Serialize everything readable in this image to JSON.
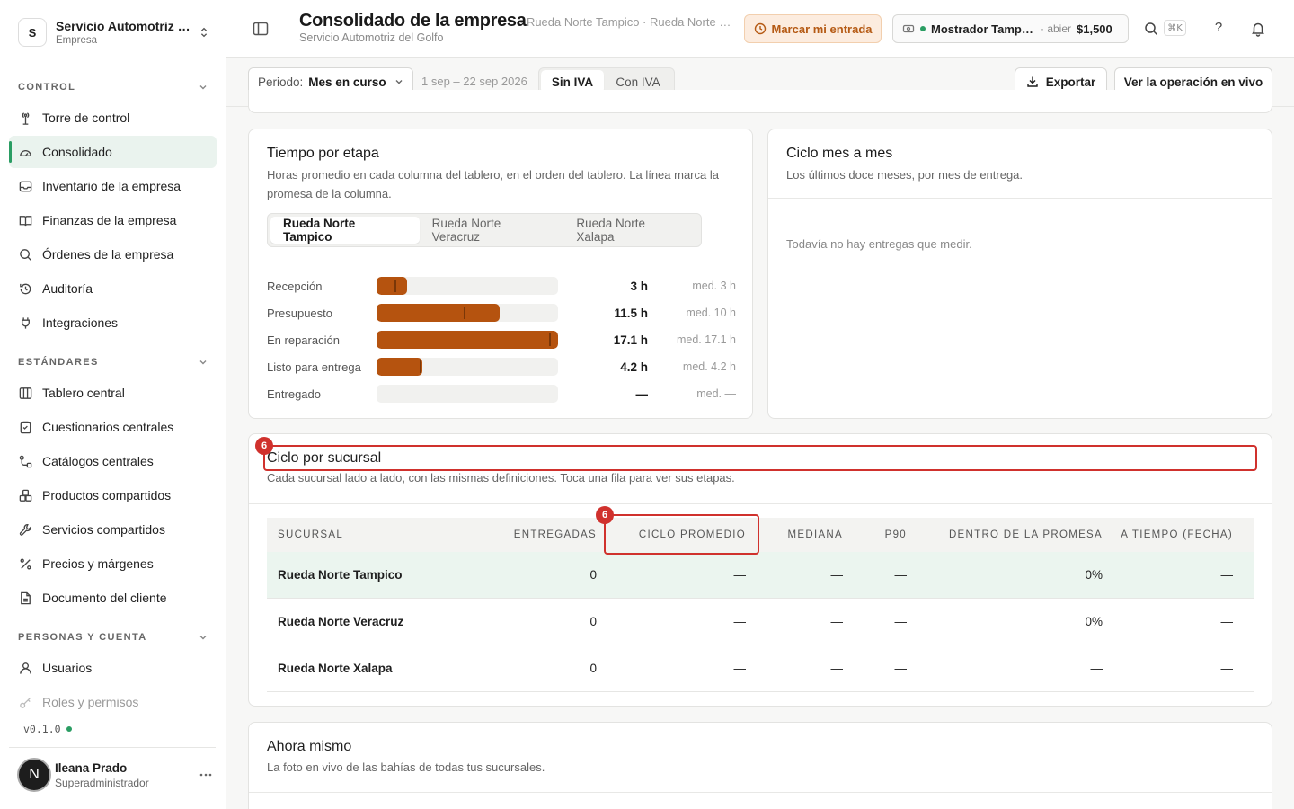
{
  "org": {
    "name": "Servicio Automotriz del Golfo",
    "type": "Empresa",
    "initial": "S"
  },
  "nav": {
    "sections": [
      {
        "label": "CONTROL"
      },
      {
        "label": "ESTÁNDARES"
      },
      {
        "label": "PERSONAS Y CUENTA"
      }
    ],
    "items": [
      {
        "label": "Torre de control",
        "icon": "tower-icon"
      },
      {
        "label": "Consolidado",
        "icon": "dashboard-icon",
        "active": true
      },
      {
        "label": "Inventario de la empresa",
        "icon": "inbox-icon"
      },
      {
        "label": "Finanzas de la empresa",
        "icon": "book-icon"
      },
      {
        "label": "Órdenes de la empresa",
        "icon": "search-icon"
      },
      {
        "label": "Auditoría",
        "icon": "history-icon"
      },
      {
        "label": "Integraciones",
        "icon": "plug-icon"
      },
      {
        "label": "Tablero central",
        "icon": "columns-icon"
      },
      {
        "label": "Cuestionarios centrales",
        "icon": "clipboard-icon"
      },
      {
        "label": "Catálogos centrales",
        "icon": "flow-icon"
      },
      {
        "label": "Productos compartidos",
        "icon": "boxes-icon"
      },
      {
        "label": "Servicios compartidos",
        "icon": "wrench-icon"
      },
      {
        "label": "Precios y márgenes",
        "icon": "percent-icon"
      },
      {
        "label": "Documento del cliente",
        "icon": "document-icon"
      },
      {
        "label": "Usuarios",
        "icon": "user-icon"
      },
      {
        "label": "Roles y permisos",
        "icon": "key-icon"
      }
    ]
  },
  "version": "v0.1.0",
  "user": {
    "name": "Ileana Prado",
    "role": "Superadministrador",
    "initial": "N"
  },
  "header": {
    "title": "Consolidado de la empresa",
    "subtitle": "Servicio Automotriz del Golfo",
    "crumb": "· Rueda Norte Tampico · Rueda Norte Veracruz · Rueda Norte Xalapa",
    "entry_button": "Marcar mi entrada",
    "counter": {
      "name": "Mostrador Tampico",
      "status": "· abierto",
      "amount": "$1,500"
    },
    "kbd": "⌘K",
    "help": "?"
  },
  "toolbar": {
    "period_label": "Periodo:",
    "period_value": "Mes en curso",
    "range": "1 sep – 22 sep 2026",
    "tax_on": "Sin IVA",
    "tax_off": "Con IVA",
    "export": "Exportar",
    "live": "Ver la operación en vivo"
  },
  "stage_card": {
    "title": "Tiempo por etapa",
    "desc": "Horas promedio en cada columna del tablero, en el orden del tablero. La línea marca la promesa de la columna.",
    "tabs": [
      "Rueda Norte Tampico",
      "Rueda Norte Veracruz",
      "Rueda Norte Xalapa"
    ],
    "rows": [
      {
        "label": "Recepción",
        "fill": 0.17,
        "mark": 0.1,
        "value": "3 h",
        "median": "med. 3 h"
      },
      {
        "label": "Presupuesto",
        "fill": 0.68,
        "mark": 0.48,
        "value": "11.5 h",
        "median": "med. 10 h"
      },
      {
        "label": "En reparación",
        "fill": 1.0,
        "mark": 0.95,
        "value": "17.1 h",
        "median": "med. 17.1 h"
      },
      {
        "label": "Listo para entrega",
        "fill": 0.25,
        "mark": 0.24,
        "value": "4.2 h",
        "median": "med. 4.2 h"
      },
      {
        "label": "Entregado",
        "fill": 0,
        "mark": null,
        "value": "—",
        "median": "med. —"
      }
    ]
  },
  "cycle_card": {
    "title": "Ciclo mes a mes",
    "desc": "Los últimos doce meses, por mes de entrega.",
    "empty": "Todavía no hay entregas que medir."
  },
  "branch_card": {
    "title": "Ciclo por sucursal",
    "desc": "Cada sucursal lado a lado, con las mismas definiciones. Toca una fila para ver sus etapas.",
    "columns": [
      "SUCURSAL",
      "ENTREGADAS",
      "CICLO PROMEDIO",
      "MEDIANA",
      "P90",
      "DENTRO DE LA PROMESA",
      "A TIEMPO (FECHA)"
    ],
    "rows": [
      [
        "Rueda Norte Tampico",
        "0",
        "—",
        "—",
        "—",
        "0%",
        "—"
      ],
      [
        "Rueda Norte Veracruz",
        "0",
        "—",
        "—",
        "—",
        "0%",
        "—"
      ],
      [
        "Rueda Norte Xalapa",
        "0",
        "—",
        "—",
        "—",
        "—",
        "—"
      ]
    ]
  },
  "now_card": {
    "title": "Ahora mismo",
    "desc": "La foto en vivo de las bahías de todas tus sucursales."
  },
  "annotations": [
    {
      "label": "6"
    },
    {
      "label": "6"
    }
  ],
  "colors": {
    "accent": "#2a9d63",
    "bar": "#b5530f",
    "annotation": "#d0312d",
    "entry_bg": "#fcecdf"
  }
}
